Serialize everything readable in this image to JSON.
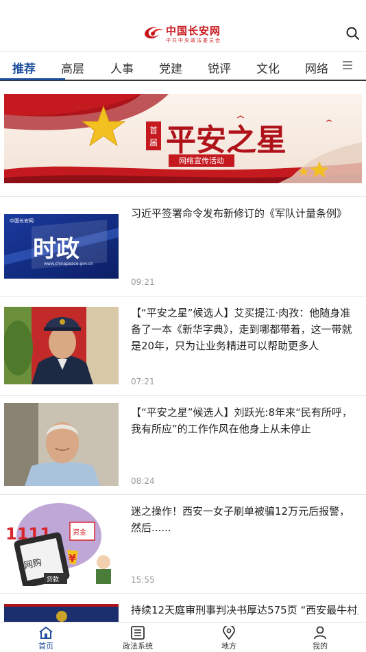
{
  "header": {
    "brand": "中国长安网",
    "subtitle": "中共中央政法委员会",
    "brand_color": "#c8161d"
  },
  "tabs": [
    {
      "label": "推荐",
      "active": true
    },
    {
      "label": "高层"
    },
    {
      "label": "人事"
    },
    {
      "label": "党建"
    },
    {
      "label": "锐评"
    },
    {
      "label": "文化"
    },
    {
      "label": "网络"
    }
  ],
  "banner": {
    "badge": "首届",
    "title": "平安之星",
    "subtitle": "网络宣传活动"
  },
  "news": [
    {
      "title": "习近平签署命令发布新修订的《军队计量条例》",
      "time": "09:21",
      "thumb_text": "时政",
      "thumb_logo": "中国长安网",
      "thumb_url": "www.chinapeace.gov.cn"
    },
    {
      "title": "【“平安之星”候选人】艾买提江·肉孜：他随身准备了一本《新华字典》，走到哪都带着，这一带就是20年，只为让业务精进可以帮助更多人",
      "time": "07:21"
    },
    {
      "title": "【“平安之星”候选人】刘跃光:8年来“民有所呼，我有所应”的工作作风在他身上从未停止",
      "time": "08:24"
    },
    {
      "title": "迷之操作！西安一女子刷单被骗12万元后报警，然后......",
      "time": "15:55",
      "thumb_texts": [
        "1111",
        "网购",
        "贷款",
        "资金"
      ]
    },
    {
      "title": "持续12天庭审刑事判决书厚达575页 “西安最牛村支"
    }
  ],
  "bottom_nav": [
    {
      "label": "首页",
      "icon": "home-icon",
      "active": true
    },
    {
      "label": "政法系统",
      "icon": "list-icon"
    },
    {
      "label": "地方",
      "icon": "location-pin-icon"
    },
    {
      "label": "我的",
      "icon": "user-icon"
    }
  ],
  "accent": "#1f4e9c"
}
